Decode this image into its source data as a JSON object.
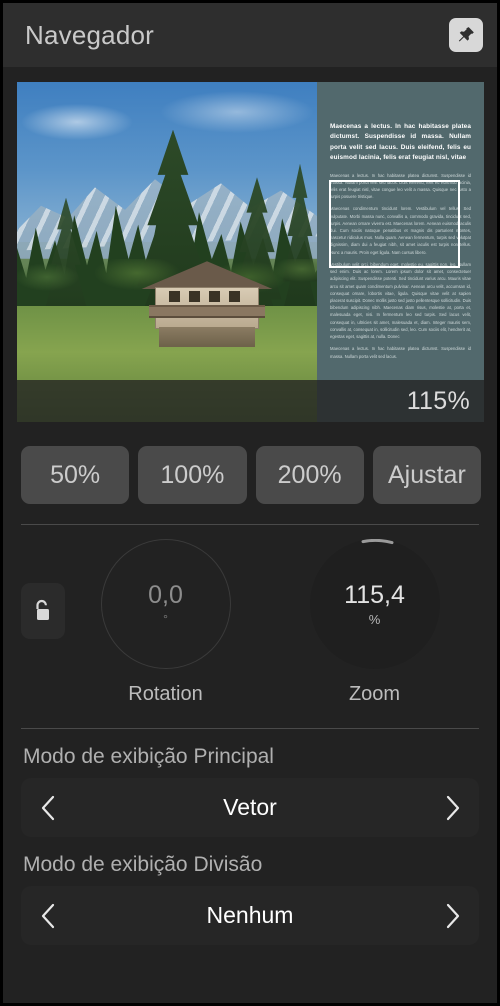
{
  "header": {
    "title": "Navegador",
    "pin_icon": "pin-icon"
  },
  "preview": {
    "zoom_overlay_label": "115%",
    "doc_heading": "Maecenas a lectus. In hac habitasse platea dictumst. Suspendisse id massa. Nullam porta velit sed lacus. Duis eleifend, felis eu euismod lacinia, felis erat feugiat nisl, vitae",
    "doc_paragraphs": [
      "Maecenas a lectus. In hac habitasse platea dictumst. Suspendisse id massa. Nullam porta velit sed lacus. Duis eleifend, felis eu euismod lacinia, felis erat feugiat nisl, vitae congue leo velit a massa. Quisque nec justo a turpis posuere tristique.",
      "Maecenas condimentum tincidunt lorem. Vestibulum vel tellus. Sed vulputate. Morbi massa nunc, convallis a, commodo gravida, tincidunt sed, turpis. Aenean ornare viverra est. Maecenas lorem. Aenean euismod iaculis dui. Cum sociis natoque penatibus et magnis dis parturient montes, nascetur ridiculus mus. Nulla quam. Aenean fermentum, turpis sed volutpat dignissim, diam dui a feugiat nibh, sit amet iaculis est turpis non tellus. Nunc a mauris. Proin eget ligula. Nam cursus libero.",
      "Vestibulum velit orci, bibendum eget, molestie eu, sagittis non, leo. Nullam sed enim. Duis ac lorem. Lorem ipsum dolor sit amet, consectetuer adipiscing elit. Suspendisse potenti. Sed tincidunt varius arcu. Mauris vitae arcu sit amet quam condimentum pulvinar. Aenean arcu velit, accumsan id, consequat ornare, lobortis vitae, ligula. Quisque vitae velit at sapien placerat suscipit. Donec mollis justo sed justo pellentesque sollicitudin. Duis bibendum adipiscing nibh. Maecenas diam risus, molestie at, porta et, malesuada eget, nisi. In fermentum leo sed turpis. Sed lacus velit, consequat in, ultricies sit amet, malesuada et, diam. Integer mauris sem, convallis at, consequat in, sollicitudin sed, leo. Cum sociis elit, hendrerit at, egestas eget, sagittis at, nulla. Donec",
      "Maecenas a lectus. In hac habitasse platea dictumst. Suspendisse id massa. Nullam porta velit sed lacus."
    ],
    "selection_rect": "selection-rectangle"
  },
  "presets": [
    {
      "label": "50%"
    },
    {
      "label": "100%"
    },
    {
      "label": "200%"
    },
    {
      "label": "Ajustar"
    }
  ],
  "dials": {
    "lock_icon": "unlock-icon",
    "rotation": {
      "value": "0,0",
      "unit": "°",
      "label": "Rotation"
    },
    "zoom": {
      "value": "115,4",
      "unit": "%",
      "label": "Zoom"
    }
  },
  "display_modes": [
    {
      "label": "Modo de exibição Principal",
      "value": "Vetor",
      "prev_icon": "chevron-left-icon",
      "next_icon": "chevron-right-icon"
    },
    {
      "label": "Modo de exibição Divisão",
      "value": "Nenhum",
      "prev_icon": "chevron-left-icon",
      "next_icon": "chevron-right-icon"
    }
  ],
  "colors": {
    "background": "#222222",
    "header": "#2e2e2e",
    "panel_teal": "#52696d",
    "button": "#4a4a4a",
    "accent_text": "#ffffff"
  }
}
